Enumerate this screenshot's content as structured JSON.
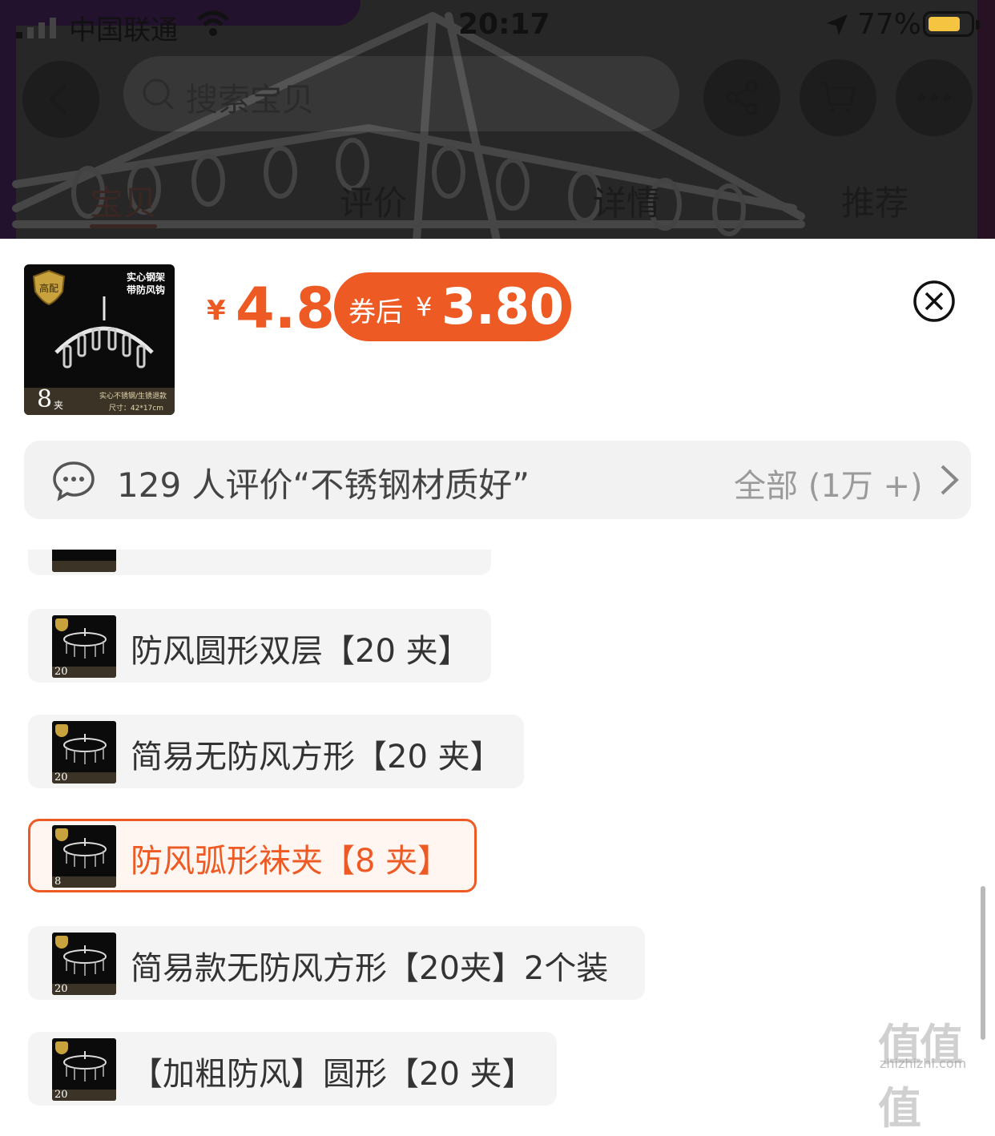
{
  "status_bar": {
    "carrier": "中国联通",
    "time": "20:17",
    "battery_percent": "77%",
    "battery_level": 0.77,
    "icons": [
      "signal-icon",
      "wifi-icon",
      "location-arrow-icon",
      "battery-icon"
    ]
  },
  "nav": {
    "search_placeholder": "搜索宝贝",
    "icons": [
      "back-icon",
      "search-icon",
      "share-icon",
      "cart-icon",
      "more-icon"
    ],
    "tabs": [
      {
        "label": "宝贝",
        "active": true
      },
      {
        "label": "评价",
        "active": false
      },
      {
        "label": "详情",
        "active": false
      },
      {
        "label": "推荐",
        "active": false
      }
    ]
  },
  "sheet": {
    "thumb": {
      "title_line1": "实心钢架",
      "title_line2": "带防风钩",
      "badge": "高配",
      "clip_count": "8",
      "clip_unit": "夹",
      "note": "实心不锈钢/生锈退款",
      "size": "尺寸：42*17cm"
    },
    "price_symbol": "¥",
    "price": "4.8",
    "coupon_label": "券后",
    "coupon_symbol": "¥",
    "coupon_price": "3.80",
    "review": {
      "text": "129 人评价“不锈钢材质好”",
      "all_label": "全部 (1万 +)"
    },
    "variants": [
      {
        "label": "防风圆形双层【20 夹】",
        "clip_count": "20",
        "selected": false
      },
      {
        "label": "简易无防风方形【20 夹】",
        "clip_count": "20",
        "selected": false
      },
      {
        "label": "防风弧形袜夹【8 夹】",
        "clip_count": "8",
        "selected": true
      },
      {
        "label": "简易款无防风方形【20夹】2个装",
        "clip_count": "20",
        "selected": false
      },
      {
        "label": "【加粗防风】圆形【20 夹】",
        "clip_count": "20",
        "selected": false
      }
    ]
  },
  "colors": {
    "accent": "#ee5a24",
    "review_bg": "#f2f2f2",
    "variant_bg": "#f4f4f4"
  },
  "watermark": {
    "main": "值值值",
    "sub": "zhizhizhi.com"
  }
}
